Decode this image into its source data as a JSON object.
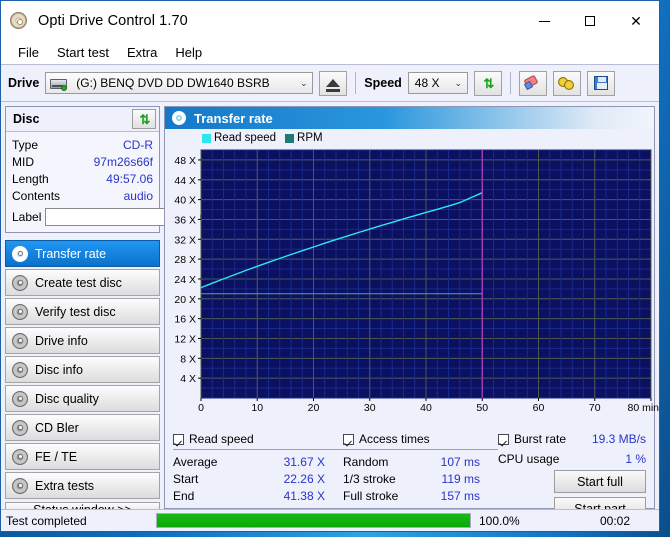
{
  "window": {
    "title": "Opti Drive Control 1.70",
    "icon": "cd-disc-icon",
    "minimize": "–",
    "maximize": "□",
    "close": "✕"
  },
  "menubar": {
    "items": [
      "File",
      "Start test",
      "Extra",
      "Help"
    ]
  },
  "toolbar": {
    "drive_label": "Drive",
    "drive_value": "(G:)   BENQ DVD DD DW1640 BSRB",
    "drive_arrow": "⌄",
    "eject_title": "eject",
    "speed_label": "Speed",
    "speed_value": "48 X",
    "speed_arrow": "⌄",
    "refresh_icon": "⇅",
    "buttons": [
      "eject-button",
      "refresh-button",
      "erase-button",
      "tools-button",
      "save-button"
    ]
  },
  "disc_panel": {
    "title": "Disc",
    "refresh_icon": "⇅",
    "rows": [
      {
        "key": "Type",
        "value": "CD-R"
      },
      {
        "key": "MID",
        "value": "97m26s66f"
      },
      {
        "key": "Length",
        "value": "49:57.06"
      },
      {
        "key": "Contents",
        "value": "audio"
      }
    ],
    "label_key": "Label",
    "label_value": "",
    "label_placeholder": ""
  },
  "sidebar": {
    "items": [
      {
        "label": "Transfer rate",
        "active": true
      },
      {
        "label": "Create test disc",
        "active": false
      },
      {
        "label": "Verify test disc",
        "active": false
      },
      {
        "label": "Drive info",
        "active": false
      },
      {
        "label": "Disc info",
        "active": false
      },
      {
        "label": "Disc quality",
        "active": false
      },
      {
        "label": "CD Bler",
        "active": false
      },
      {
        "label": "FE / TE",
        "active": false
      },
      {
        "label": "Extra tests",
        "active": false
      }
    ],
    "status_window": "Status window >>"
  },
  "panel": {
    "title": "Transfer rate"
  },
  "chart_data": {
    "type": "line",
    "title": "Transfer rate",
    "xlabel": "min",
    "ylabel": "X",
    "xlim": [
      0,
      80
    ],
    "ylim": [
      0,
      50
    ],
    "xticks": [
      0,
      10,
      20,
      30,
      40,
      50,
      60,
      70,
      80
    ],
    "xtick_labels": [
      "0",
      "10",
      "20",
      "30",
      "40",
      "50",
      "60",
      "70",
      "80 min"
    ],
    "yticks": [
      4,
      8,
      12,
      16,
      20,
      24,
      28,
      32,
      36,
      40,
      44,
      48
    ],
    "ytick_labels": [
      "4 X",
      "8 X",
      "12 X",
      "16 X",
      "20 X",
      "24 X",
      "28 X",
      "32 X",
      "36 X",
      "40 X",
      "44 X",
      "48 X"
    ],
    "grid": true,
    "background": "#0b1060",
    "plot_end_marker_x": 50,
    "plot_end_marker_color": "#b43cc8",
    "legend": [
      {
        "name": "Read speed",
        "color": "#2ee6f0"
      },
      {
        "name": "RPM",
        "color": "#1b7b77"
      }
    ],
    "series": [
      {
        "name": "Read speed",
        "color": "#2ee6f0",
        "x": [
          0,
          2,
          4,
          6,
          8,
          10,
          12,
          14,
          16,
          18,
          20,
          22,
          24,
          26,
          28,
          30,
          32,
          34,
          36,
          38,
          40,
          42,
          44,
          46,
          48,
          49.95
        ],
        "values": [
          22.26,
          23.15,
          24.02,
          24.88,
          25.72,
          26.55,
          27.36,
          28.15,
          28.93,
          29.7,
          30.45,
          31.2,
          31.93,
          32.65,
          33.36,
          34.06,
          34.75,
          35.43,
          36.1,
          36.76,
          37.41,
          38.05,
          38.68,
          39.4,
          40.4,
          41.38
        ]
      },
      {
        "name": "RPM",
        "color": "#4ba8a2",
        "x": [
          0,
          10,
          20,
          30,
          40,
          49.95
        ],
        "values": [
          21.0,
          21.0,
          21.0,
          21.0,
          21.0,
          21.0
        ]
      }
    ]
  },
  "results": {
    "read_speed": {
      "title": "Read speed",
      "checked": true,
      "rows": [
        {
          "key": "Average",
          "value": "31.67 X"
        },
        {
          "key": "Start",
          "value": "22.26 X"
        },
        {
          "key": "End",
          "value": "41.38 X"
        }
      ]
    },
    "access_times": {
      "title": "Access times",
      "checked": true,
      "rows": [
        {
          "key": "Random",
          "value": "107 ms"
        },
        {
          "key": "1/3 stroke",
          "value": "119 ms"
        },
        {
          "key": "Full stroke",
          "value": "157 ms"
        }
      ]
    },
    "burst_rate": {
      "title": "Burst rate",
      "checked": true,
      "value": "19.3 MB/s",
      "cpu_key": "CPU usage",
      "cpu_value": "1 %",
      "start_full": "Start full",
      "start_part": "Start part"
    }
  },
  "statusbar": {
    "message": "Test completed",
    "progress_percent": 100.0,
    "progress_text": "100.0%",
    "elapsed": "00:02"
  }
}
